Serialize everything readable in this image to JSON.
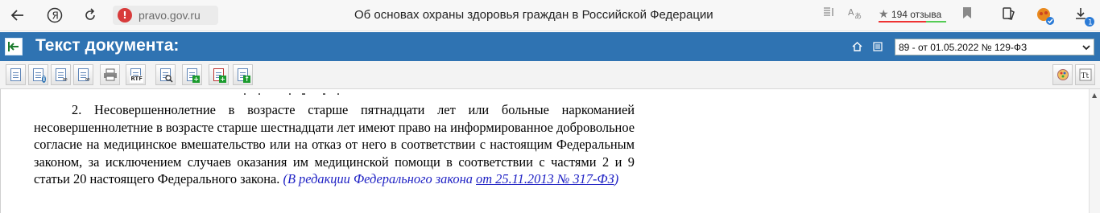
{
  "browser": {
    "back_icon": "arrow-left-icon",
    "yandex_icon": "yandex-logo",
    "reload_icon": "reload-icon",
    "url": "pravo.gov.ru",
    "tab_title": "Об основах охраны здоровья граждан в Российской Федерации",
    "reviews_count": "194 отзыва",
    "accent_warning": "#d83b3b"
  },
  "header": {
    "title": "Текст документа:",
    "version_selected": "89 - от 01.05.2022 № 129-ФЗ",
    "bg_color": "#2f73b2"
  },
  "content": {
    "paragraph": "2. Несовершеннолетние в возрасте старше пятнадцати лет или больные наркоманией несовершеннолетние в возрасте старше шестнадцати лет имеют право на информированное добровольное согласие на медицинское вмешательство или на отказ от него в соответствии с настоящим Федеральным законом, за исключением случаев оказания им медицинской помощи в соответствии с частями 2 и 9 статьи 20 настоящего Федерального закона.",
    "edit_note_prefix": "(В редакции Федерального закона",
    "edit_note_link": "от 25.11.2013 № 317-ФЗ",
    "edit_note_suffix": ")",
    "link_color": "#1e21c4"
  }
}
